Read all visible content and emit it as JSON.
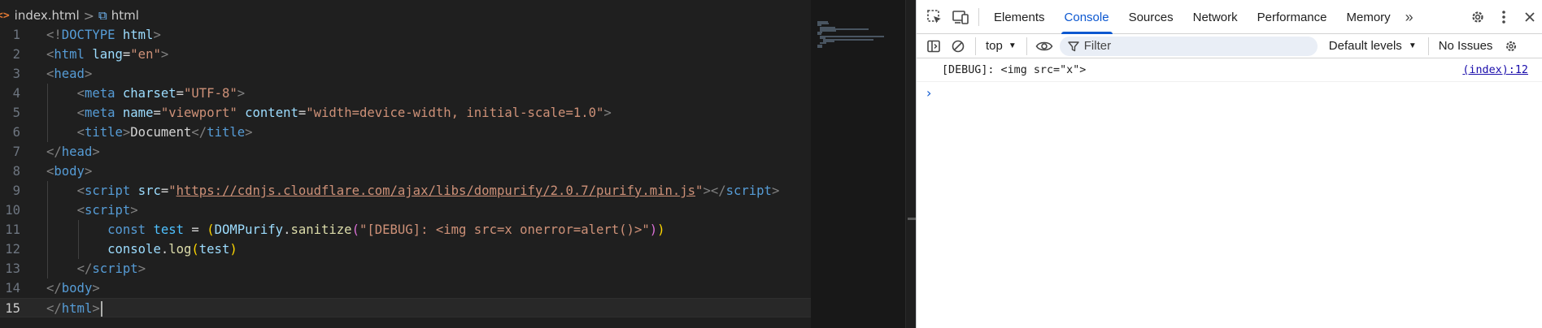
{
  "breadcrumb": {
    "file_icon": "<>",
    "file_name": "index.html",
    "separator": ">",
    "element_icon": "⧉",
    "element_name": "html"
  },
  "editor": {
    "active_line": "15",
    "lines": [
      {
        "n": "1",
        "tokens": [
          [
            "<!",
            "tag"
          ],
          [
            "DOCTYPE",
            "name"
          ],
          [
            " ",
            "text"
          ],
          [
            "html",
            "attr"
          ],
          [
            ">",
            "tag"
          ]
        ]
      },
      {
        "n": "2",
        "tokens": [
          [
            "<",
            "tag"
          ],
          [
            "html",
            "name"
          ],
          [
            " ",
            "text"
          ],
          [
            "lang",
            "attr"
          ],
          [
            "=",
            "text"
          ],
          [
            "\"en\"",
            "str"
          ],
          [
            ">",
            "tag"
          ]
        ]
      },
      {
        "n": "3",
        "tokens": [
          [
            "<",
            "tag"
          ],
          [
            "head",
            "name"
          ],
          [
            ">",
            "tag"
          ]
        ]
      },
      {
        "n": "4",
        "tokens": [
          [
            "    ",
            "text"
          ],
          [
            "<",
            "tag"
          ],
          [
            "meta",
            "name"
          ],
          [
            " ",
            "text"
          ],
          [
            "charset",
            "attr"
          ],
          [
            "=",
            "text"
          ],
          [
            "\"UTF-8\"",
            "str"
          ],
          [
            ">",
            "tag"
          ]
        ]
      },
      {
        "n": "5",
        "tokens": [
          [
            "    ",
            "text"
          ],
          [
            "<",
            "tag"
          ],
          [
            "meta",
            "name"
          ],
          [
            " ",
            "text"
          ],
          [
            "name",
            "attr"
          ],
          [
            "=",
            "text"
          ],
          [
            "\"viewport\"",
            "str"
          ],
          [
            " ",
            "text"
          ],
          [
            "content",
            "attr"
          ],
          [
            "=",
            "text"
          ],
          [
            "\"width=device-width, initial-scale=1.0\"",
            "str"
          ],
          [
            ">",
            "tag"
          ]
        ]
      },
      {
        "n": "6",
        "tokens": [
          [
            "    ",
            "text"
          ],
          [
            "<",
            "tag"
          ],
          [
            "title",
            "name"
          ],
          [
            ">",
            "tag"
          ],
          [
            "Document",
            "text"
          ],
          [
            "</",
            "tag"
          ],
          [
            "title",
            "name"
          ],
          [
            ">",
            "tag"
          ]
        ]
      },
      {
        "n": "7",
        "tokens": [
          [
            "</",
            "tag"
          ],
          [
            "head",
            "name"
          ],
          [
            ">",
            "tag"
          ]
        ]
      },
      {
        "n": "8",
        "tokens": [
          [
            "<",
            "tag"
          ],
          [
            "body",
            "name"
          ],
          [
            ">",
            "tag"
          ]
        ]
      },
      {
        "n": "9",
        "tokens": [
          [
            "    ",
            "text"
          ],
          [
            "<",
            "tag"
          ],
          [
            "script",
            "name"
          ],
          [
            " ",
            "text"
          ],
          [
            "src",
            "attr"
          ],
          [
            "=",
            "text"
          ],
          [
            "\"",
            "str"
          ],
          [
            "https://cdnjs.cloudflare.com/ajax/libs/dompurify/2.0.7/purify.min.js",
            "link"
          ],
          [
            "\"",
            "str"
          ],
          [
            "></",
            "tag"
          ],
          [
            "script",
            "name"
          ],
          [
            ">",
            "tag"
          ]
        ]
      },
      {
        "n": "10",
        "tokens": [
          [
            "    ",
            "text"
          ],
          [
            "<",
            "tag"
          ],
          [
            "script",
            "name"
          ],
          [
            ">",
            "tag"
          ]
        ]
      },
      {
        "n": "11",
        "tokens": [
          [
            "        ",
            "text"
          ],
          [
            "const",
            "kw"
          ],
          [
            " ",
            "text"
          ],
          [
            "test",
            "var"
          ],
          [
            " = ",
            "text"
          ],
          [
            "(",
            "br1"
          ],
          [
            "DOMPurify",
            "obj"
          ],
          [
            ".",
            "text"
          ],
          [
            "sanitize",
            "fn"
          ],
          [
            "(",
            "br2"
          ],
          [
            "\"[DEBUG]: <img src=x onerror=alert()>\"",
            "str"
          ],
          [
            ")",
            "br2"
          ],
          [
            ")",
            "br1"
          ]
        ]
      },
      {
        "n": "12",
        "tokens": [
          [
            "        ",
            "text"
          ],
          [
            "console",
            "obj"
          ],
          [
            ".",
            "text"
          ],
          [
            "log",
            "fn"
          ],
          [
            "(",
            "br1"
          ],
          [
            "test",
            "obj"
          ],
          [
            ")",
            "br1"
          ]
        ]
      },
      {
        "n": "13",
        "tokens": [
          [
            "    ",
            "text"
          ],
          [
            "</",
            "tag"
          ],
          [
            "script",
            "name"
          ],
          [
            ">",
            "tag"
          ]
        ]
      },
      {
        "n": "14",
        "tokens": [
          [
            "</",
            "tag"
          ],
          [
            "body",
            "name"
          ],
          [
            ">",
            "tag"
          ]
        ]
      },
      {
        "n": "15",
        "tokens": [
          [
            "</",
            "tag"
          ],
          [
            "html",
            "name"
          ],
          [
            ">",
            "tag"
          ]
        ]
      }
    ]
  },
  "devtools": {
    "tabs": [
      "Elements",
      "Console",
      "Sources",
      "Network",
      "Performance",
      "Memory"
    ],
    "active_tab": "Console",
    "more_tabs_label": "»",
    "toolbar": {
      "context": "top",
      "filter_placeholder": "Filter",
      "levels": "Default levels",
      "issues": "No Issues"
    },
    "console": {
      "messages": [
        {
          "text": "[DEBUG]: <img src=\"x\">",
          "source": "(index):12"
        }
      ],
      "prompt_symbol": "›"
    }
  },
  "colors": {
    "accent": "#0b57d0",
    "editor_bg": "#1f1f1f",
    "link": "#1a0dab"
  }
}
